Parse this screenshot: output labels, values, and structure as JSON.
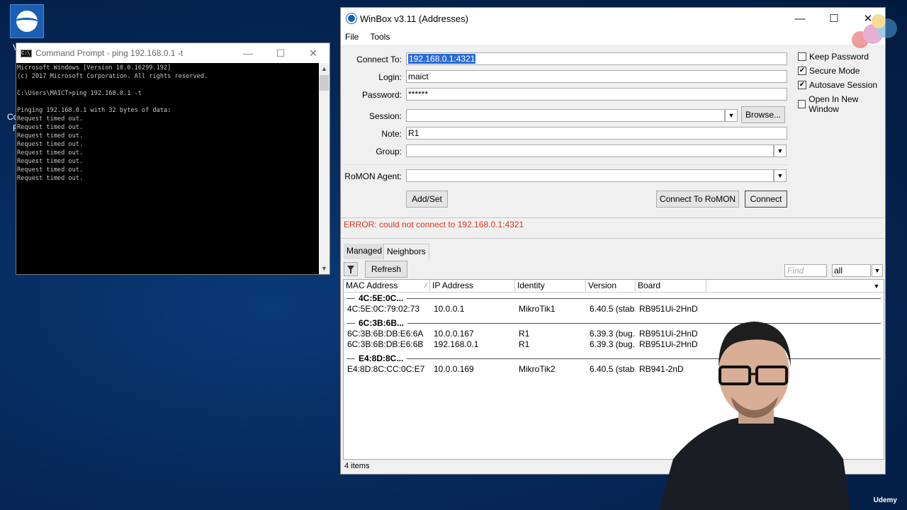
{
  "desktop": {
    "fragments": [
      "V",
      "Co",
      "F"
    ]
  },
  "cmd": {
    "title": "Command Prompt - ping  192.168.0.1 -t",
    "lines": [
      "Microsoft Windows [Version 10.0.16299.192]",
      "(c) 2017 Microsoft Corporation. All rights reserved.",
      "",
      "C:\\Users\\MAICT>ping 192.168.0.1 -t",
      "",
      "Pinging 192.168.0.1 with 32 bytes of data:",
      "Request timed out.",
      "Request timed out.",
      "Request timed out.",
      "Request timed out.",
      "Request timed out.",
      "Request timed out.",
      "Request timed out.",
      "Request timed out."
    ]
  },
  "winbox": {
    "title": "WinBox v3.11 (Addresses)",
    "menu": [
      "File",
      "Tools"
    ],
    "form": {
      "connect_to_label": "Connect To:",
      "connect_to_value": "192.168.0.1:4321",
      "login_label": "Login:",
      "login_value": "maict",
      "password_label": "Password:",
      "password_value": "******",
      "session_label": "Session:",
      "session_value": "",
      "browse_label": "Browse...",
      "note_label": "Note:",
      "note_value": "R1",
      "group_label": "Group:",
      "group_value": "",
      "romon_label": "RoMON Agent:",
      "romon_value": "",
      "add_set_label": "Add/Set",
      "connect_romon_label": "Connect To RoMON",
      "connect_label": "Connect"
    },
    "options": [
      {
        "label": "Keep Password",
        "checked": false
      },
      {
        "label": "Secure Mode",
        "checked": true
      },
      {
        "label": "Autosave Session",
        "checked": true
      },
      {
        "label": "Open In New Window",
        "checked": false
      }
    ],
    "error": "ERROR: could not connect to 192.168.0.1:4321",
    "tabs": [
      "Managed",
      "Neighbors"
    ],
    "active_tab": "Neighbors",
    "refresh_label": "Refresh",
    "find_placeholder": "Find",
    "filter_value": "all",
    "columns": [
      "MAC Address",
      "IP Address",
      "Identity",
      "Version",
      "Board"
    ],
    "groups": [
      {
        "name": "4C:5E:0C...",
        "rows": [
          [
            "4C:5E:0C:79:02:73",
            "10.0.0.1",
            "MikroTik1",
            "6.40.5 (stab...",
            "RB951Ui-2HnD"
          ]
        ]
      },
      {
        "name": "6C:3B:6B...",
        "rows": [
          [
            "6C:3B:6B:DB:E6:6A",
            "10.0.0.167",
            "R1",
            "6.39.3 (bug...",
            "RB951Ui-2HnD"
          ],
          [
            "6C:3B:6B:DB:E6:6B",
            "192.168.0.1",
            "R1",
            "6.39.3 (bug...",
            "RB951Ui-2HnD"
          ]
        ]
      },
      {
        "name": "E4:8D:8C...",
        "rows": [
          [
            "E4:8D:8C:CC:0C:E7",
            "10.0.0.169",
            "MikroTik2",
            "6.40.5 (stab...",
            "RB941-2nD"
          ]
        ]
      }
    ],
    "status": "4 items"
  },
  "watermark": "Udemy"
}
